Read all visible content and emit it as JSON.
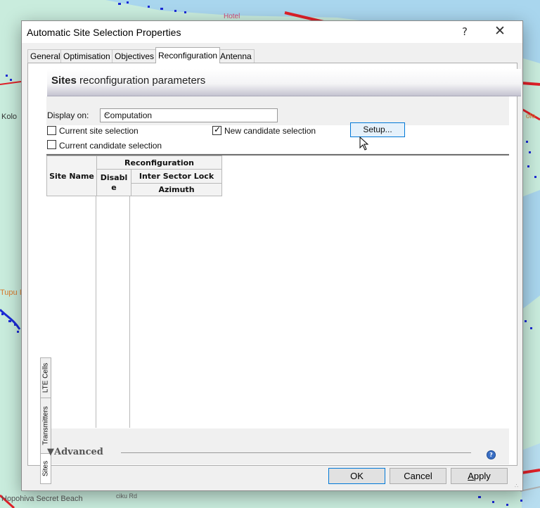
{
  "map": {
    "labels": [
      "Kolo",
      "Tupu I",
      "Hopohiva Secret Beach",
      "Hotel",
      "olo",
      "ciku Rd"
    ]
  },
  "dialog": {
    "title": "Automatic Site Selection Properties",
    "help_label": "?",
    "close_label": "✕",
    "tabs": [
      "General",
      "Optimisation",
      "Objectives",
      "Reconfiguration",
      "Antenna"
    ],
    "active_tab": "Reconfiguration",
    "section": {
      "bold": "Sites",
      "rest": " reconfiguration parameters"
    },
    "display_on": {
      "label": "Display on:",
      "value": "Computation"
    },
    "checks": {
      "current_site": {
        "label": "Current site selection",
        "checked": false
      },
      "new_candidate": {
        "label": "New candidate selection",
        "checked": true
      },
      "current_candidate": {
        "label": "Current candidate selection",
        "checked": false
      }
    },
    "setup_label": "Setup...",
    "grid": {
      "site_name": "Site Name",
      "reconfiguration": "Reconfiguration",
      "disable": "Disabl e",
      "inter_sector_lock": "Inter Sector Lock",
      "azimuth": "Azimuth"
    },
    "vertical_tabs": [
      "Sites",
      "Transmitters",
      "LTE Cells"
    ],
    "advanced_label": "▼Advanced",
    "buttons": {
      "ok": "OK",
      "cancel": "Cancel",
      "apply_prefix": "A",
      "apply_rest": "pply"
    }
  }
}
